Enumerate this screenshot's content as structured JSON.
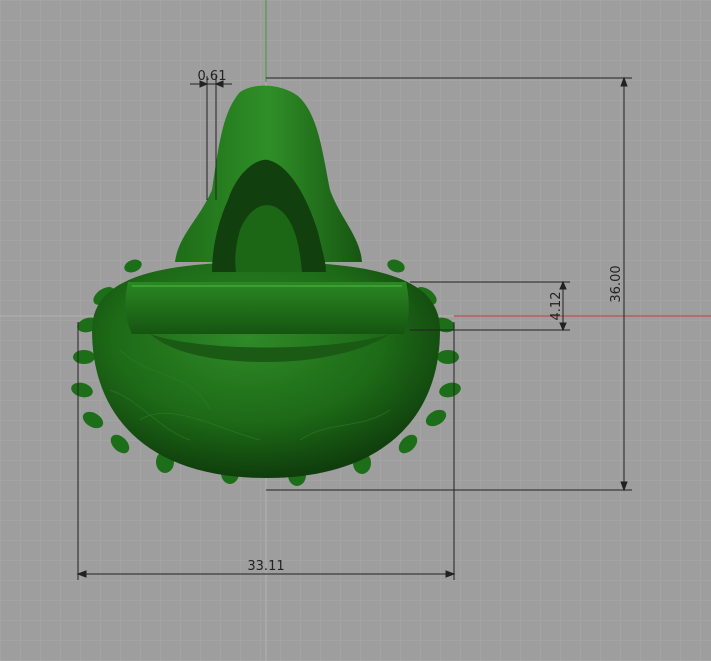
{
  "viewport": {
    "background": "#9e9e9e",
    "grid_minor": "#a8a8a8",
    "grid_major": "#b6b6b6",
    "axis_x_color": "#c83c3c",
    "axis_y_color": "#3c9a3c",
    "model_color": "#1f6e1a"
  },
  "dimensions": {
    "thickness": "0.61",
    "band_height": "4.12",
    "height": "36.00",
    "width": "33.11"
  }
}
